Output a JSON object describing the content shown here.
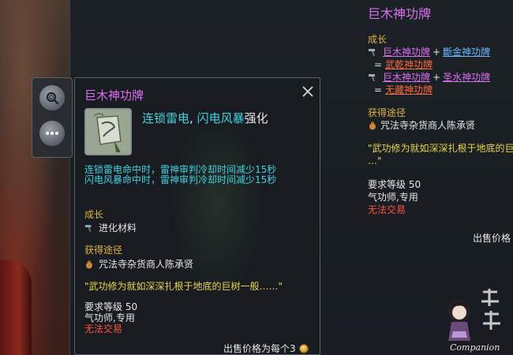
{
  "colors": {
    "item_name": "#d96ff0",
    "section": "#e2b240",
    "effect": "#40d0e0",
    "quote": "#e8d44a",
    "untradable": "#ff5040",
    "link_blue": "#6ab4ff",
    "link_red": "#ff6a3c"
  },
  "side_buttons": {
    "inspect_icon": "magnifier-icon",
    "more_icon": "ellipsis-icon"
  },
  "tooltip": {
    "title": "巨木神功牌",
    "close_icon": "close-icon",
    "effect": {
      "part1": "连锁雷电",
      "sep": ", ",
      "part2": "闪电风暴",
      "suffix": "强化"
    },
    "desc_lines": [
      "连锁雷电命中时，雷神审判冷却时间减少15秒",
      "闪电风暴命中时，雷神审判冷却时间减少15秒"
    ],
    "growth_label": "成长",
    "growth_value": "进化材料",
    "source_label": "获得途径",
    "source_value": "咒法寺杂货商人陈承贤",
    "quote": "\"武功修为就如深深扎根于地底的巨树一般……\"",
    "level": "要求等级 50",
    "class": "气功师,专用",
    "trade": "无法交易",
    "price": "出售价格为每个3"
  },
  "background_tooltip": {
    "title": "巨木神功牌",
    "growth_label": "成长",
    "recipe1_a": "巨木神功牌",
    "recipe1_b": "斷金神功牌",
    "result1": "武乾神功牌",
    "recipe2_a": "巨木神功牌",
    "recipe2_b": "圣水神功牌",
    "result2": "无藏神功牌",
    "plus": "+",
    "equals": "=",
    "source_label": "获得途径",
    "source_value": "咒法寺杂货商人陈承贤",
    "quote_line1": "\"武功修为就如深深扎根于地底的巨",
    "quote_line2": "…\"",
    "level": "要求等级 50",
    "class": "气功师,专用",
    "trade": "无法交易",
    "price": "出售价格"
  },
  "logo": {
    "text": "Companion"
  }
}
